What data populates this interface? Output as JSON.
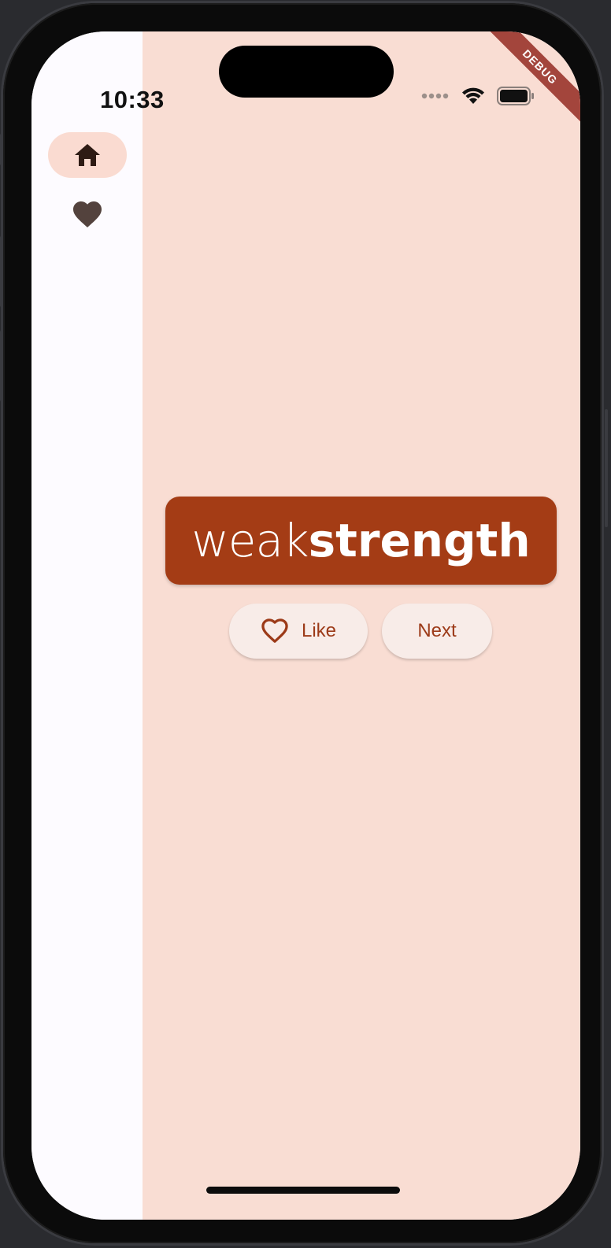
{
  "status_bar": {
    "time": "10:33",
    "icons": [
      "cellular-dots-icon",
      "wifi-icon",
      "battery-icon"
    ]
  },
  "debug_banner": "DEBUG",
  "navigation_rail": {
    "items": [
      {
        "icon": "home-icon",
        "selected": true
      },
      {
        "icon": "heart-icon",
        "selected": false
      }
    ]
  },
  "word_pair": {
    "first": "weak",
    "second": "strength"
  },
  "actions": {
    "like_label": "Like",
    "next_label": "Next"
  },
  "colors": {
    "accent": "#a43c15",
    "content_bg": "#f9ddd3",
    "rail_bg": "#fdfbff",
    "selected_indicator": "#fadbd1",
    "button_bg": "#f8ece8",
    "button_text": "#9c3a18",
    "debug_ribbon": "#a3453c"
  }
}
